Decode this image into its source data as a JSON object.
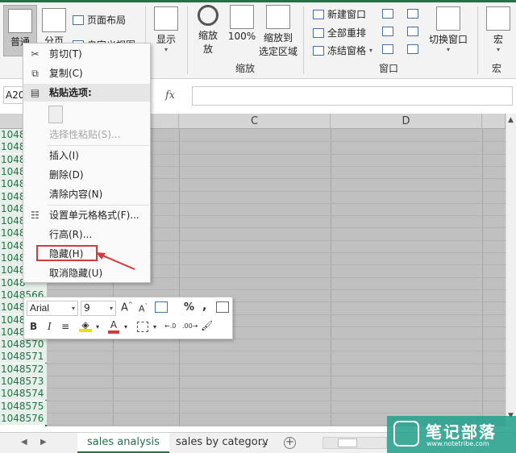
{
  "ribbon": {
    "normal": "普通",
    "page_break": "分页",
    "page_layout": "页面布局",
    "custom_view": "自定义视图",
    "show": "显示",
    "zoom": "缩放",
    "zoom_sub": "放",
    "zoom_100": "100%",
    "zoom_selection_1": "缩放到",
    "zoom_selection_2": "选定区域",
    "group_zoom": "缩放",
    "new_window": "新建窗口",
    "arrange_all": "全部重排",
    "freeze_panes": "冻结窗格",
    "group_window": "窗口",
    "switch_windows": "切换窗口",
    "macros": "宏",
    "group_macros": "宏"
  },
  "formula_bar": {
    "name_box": "A20",
    "fx": "fx"
  },
  "grid": {
    "columns": [
      "C",
      "D"
    ],
    "rows": [
      "1048",
      "1048",
      "1048",
      "1048",
      "1048",
      "1048",
      "1048",
      "1048",
      "1048",
      "1048",
      "1048",
      "1048",
      "1048",
      "1048566",
      "1048567",
      "1048568",
      "1048569",
      "1048570",
      "1048571",
      "1048572",
      "1048573",
      "1048574",
      "1048575",
      "1048576"
    ]
  },
  "context_menu": {
    "cut": "剪切(T)",
    "copy": "复制(C)",
    "paste_options": "粘贴选项:",
    "paste_special": "选择性粘贴(S)...",
    "insert": "插入(I)",
    "delete": "删除(D)",
    "clear_contents": "清除内容(N)",
    "format_cells": "设置单元格格式(F)...",
    "row_height": "行高(R)...",
    "hide": "隐藏(H)",
    "unhide": "取消隐藏(U)"
  },
  "mini_toolbar": {
    "font": "Arial",
    "size": "9",
    "percent": "%",
    "comma": ",",
    "bold": "B",
    "italic": "I",
    "font_color": "A"
  },
  "sheets": {
    "active": "sales analysis",
    "second": "sales by category",
    "more": "...",
    "add": "+"
  },
  "watermark": {
    "title": "笔记部落",
    "url": "www.notetribe.com"
  },
  "colors": {
    "accent": "#217346",
    "highlight": "#d53a3a"
  }
}
